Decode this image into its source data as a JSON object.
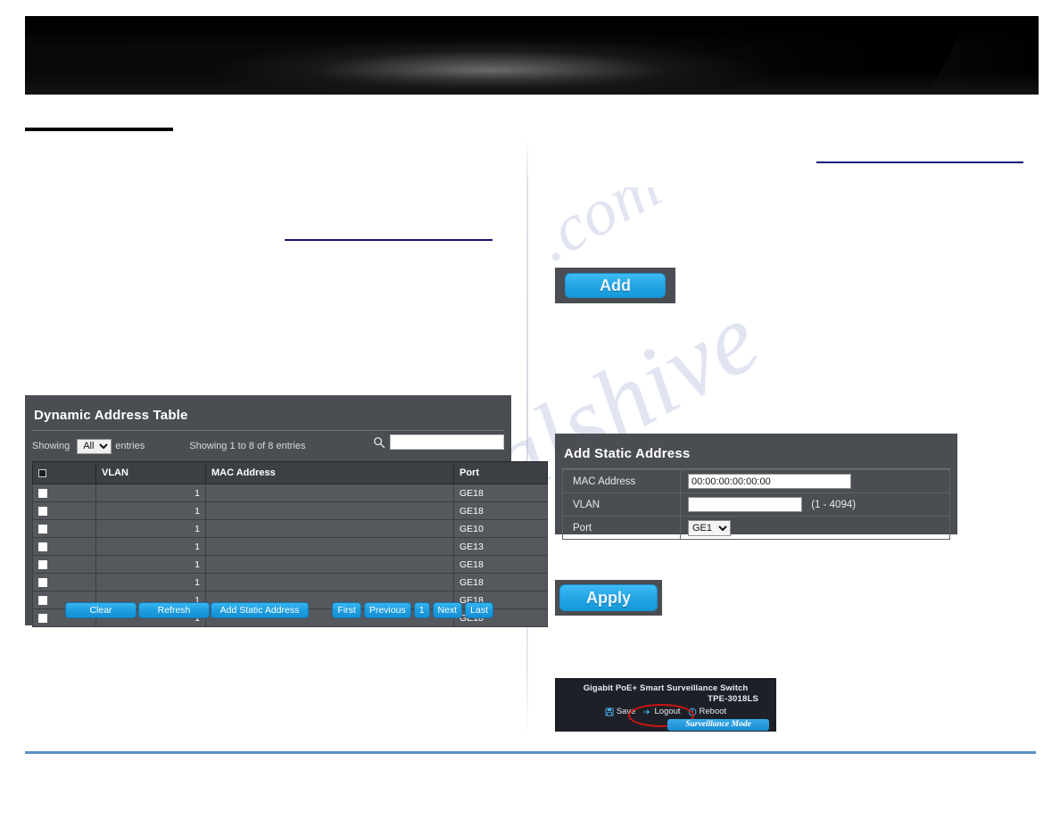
{
  "banner": {
    "alt": "product banner image"
  },
  "dynamic_table": {
    "title": "Dynamic Address Table",
    "showing_label": "Showing",
    "entries_label": "entries",
    "entries_value": "All",
    "entries_options": [
      "All"
    ],
    "info": "Showing 1 to 8 of 8 entries",
    "search_icon": "search-icon",
    "search_value": "",
    "columns": [
      "",
      "VLAN",
      "MAC Address",
      "Port"
    ],
    "rows": [
      {
        "vlan": "1",
        "mac": "",
        "port": "GE18"
      },
      {
        "vlan": "1",
        "mac": "",
        "port": "GE18"
      },
      {
        "vlan": "1",
        "mac": "",
        "port": "GE10"
      },
      {
        "vlan": "1",
        "mac": "",
        "port": "GE13"
      },
      {
        "vlan": "1",
        "mac": "",
        "port": "GE18"
      },
      {
        "vlan": "1",
        "mac": "",
        "port": "GE18"
      },
      {
        "vlan": "1",
        "mac": "",
        "port": "GE18"
      },
      {
        "vlan": "1",
        "mac": "",
        "port": "GE18"
      }
    ],
    "buttons": {
      "clear": "Clear",
      "refresh": "Refresh",
      "add_static_address": "Add Static Address"
    },
    "pager": {
      "first": "First",
      "previous": "Previous",
      "current": "1",
      "next": "Next",
      "last": "Last"
    }
  },
  "add_button": {
    "label": "Add"
  },
  "static_form": {
    "title": "Add Static Address",
    "fields": {
      "mac_label": "MAC Address",
      "mac_value": "00:00:00:00:00:00",
      "vlan_label": "VLAN",
      "vlan_value": "",
      "vlan_hint": "(1 - 4094)",
      "port_label": "Port",
      "port_value": "GE1",
      "port_options": [
        "GE1"
      ]
    }
  },
  "apply_button": {
    "label": "Apply"
  },
  "device_header": {
    "product": "Gigabit PoE+ Smart Surveillance Switch",
    "model": "TPE-3018LS",
    "save": "Save",
    "logout": "Logout",
    "reboot": "Reboot",
    "surveillance_mode": "Surveillance Mode",
    "highlight_color": "#cc1414"
  },
  "watermark": {
    "line1": "manualshive",
    "line2": ".com"
  },
  "colors": {
    "panel_bg": "#4a4d52",
    "table_header_bg": "#3c3f44",
    "table_row_bg": "#55585d",
    "accent_blue": "#1e9ee0",
    "rule_navy": "#151577",
    "rule_blue": "#5b8fc4",
    "device_bg": "#1d2127"
  }
}
